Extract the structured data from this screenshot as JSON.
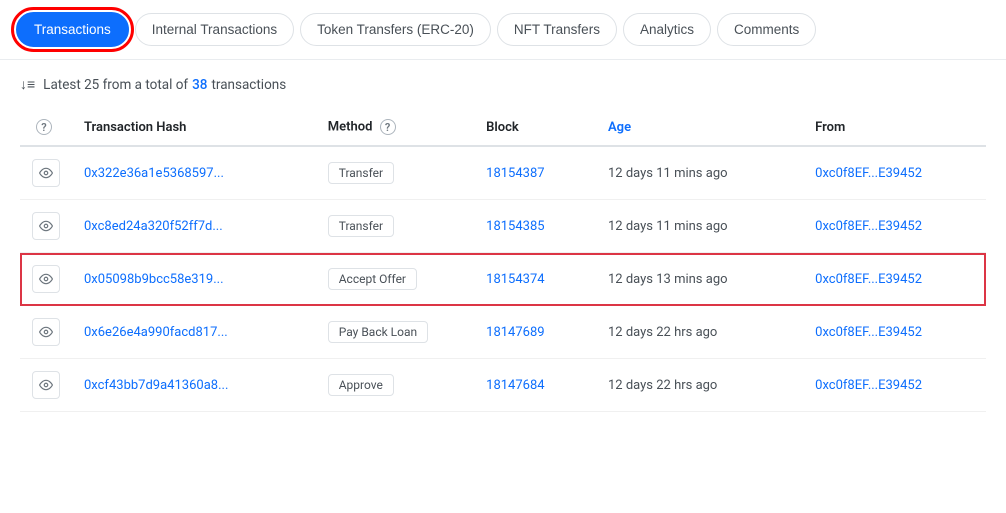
{
  "tabs": [
    {
      "id": "transactions",
      "label": "Transactions",
      "active": true
    },
    {
      "id": "internal-transactions",
      "label": "Internal Transactions",
      "active": false
    },
    {
      "id": "token-transfers",
      "label": "Token Transfers (ERC-20)",
      "active": false
    },
    {
      "id": "nft-transfers",
      "label": "NFT Transfers",
      "active": false
    },
    {
      "id": "analytics",
      "label": "Analytics",
      "active": false
    },
    {
      "id": "comments",
      "label": "Comments",
      "active": false
    }
  ],
  "summary": {
    "prefix": "Latest 25 from a total of",
    "count": "38",
    "suffix": "transactions"
  },
  "table": {
    "columns": [
      {
        "id": "icon",
        "label": ""
      },
      {
        "id": "tx-hash",
        "label": "Transaction Hash",
        "help": false
      },
      {
        "id": "method",
        "label": "Method",
        "help": true
      },
      {
        "id": "block",
        "label": "Block",
        "help": false
      },
      {
        "id": "age",
        "label": "Age",
        "blue": true,
        "help": false
      },
      {
        "id": "from",
        "label": "From",
        "help": false
      }
    ],
    "rows": [
      {
        "id": "row1",
        "highlighted": false,
        "hash": "0x322e36a1e5368597...",
        "method": "Transfer",
        "block": "18154387",
        "age": "12 days 11 mins ago",
        "from": "0xc0f8EF...E39452"
      },
      {
        "id": "row2",
        "highlighted": false,
        "hash": "0xc8ed24a320f52ff7d...",
        "method": "Transfer",
        "block": "18154385",
        "age": "12 days 11 mins ago",
        "from": "0xc0f8EF...E39452"
      },
      {
        "id": "row3",
        "highlighted": true,
        "hash": "0x05098b9bcc58e319...",
        "method": "Accept Offer",
        "block": "18154374",
        "age": "12 days 13 mins ago",
        "from": "0xc0f8EF...E39452"
      },
      {
        "id": "row4",
        "highlighted": false,
        "hash": "0x6e26e4a990facd817...",
        "method": "Pay Back Loan",
        "block": "18147689",
        "age": "12 days 22 hrs ago",
        "from": "0xc0f8EF...E39452"
      },
      {
        "id": "row5",
        "highlighted": false,
        "hash": "0xcf43bb7d9a41360a8...",
        "method": "Approve",
        "block": "18147684",
        "age": "12 days 22 hrs ago",
        "from": "0xc0f8EF...E39452"
      }
    ]
  }
}
